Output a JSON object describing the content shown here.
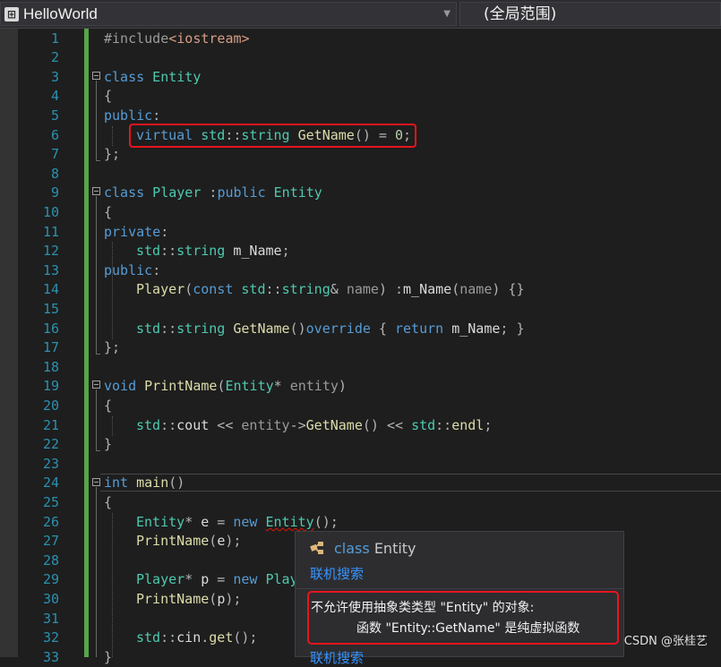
{
  "header": {
    "project_icon": "project-icon",
    "project_name": "HelloWorld",
    "scope": "(全局范围)"
  },
  "line_numbers": [
    "1",
    "2",
    "3",
    "4",
    "5",
    "6",
    "7",
    "8",
    "9",
    "10",
    "11",
    "12",
    "13",
    "14",
    "15",
    "16",
    "17",
    "18",
    "19",
    "20",
    "21",
    "22",
    "23",
    "24",
    "25",
    "26",
    "27",
    "28",
    "29",
    "30",
    "31",
    "32",
    "33"
  ],
  "code": {
    "l1": [
      "#include",
      "<iostream>"
    ],
    "l3": [
      "class",
      " Entity"
    ],
    "l4": [
      "{"
    ],
    "l5": [
      "public",
      ":"
    ],
    "l6": [
      "virtual",
      " std",
      "::",
      "string",
      " GetName",
      "()",
      " = ",
      "0",
      ";"
    ],
    "l7": [
      "};"
    ],
    "l9": [
      "class",
      " Player",
      " :",
      "public",
      " Entity"
    ],
    "l10": [
      "{"
    ],
    "l11": [
      "private",
      ":"
    ],
    "l12": [
      "std",
      "::",
      "string",
      " m_Name",
      ";"
    ],
    "l13": [
      "public",
      ":"
    ],
    "l14": [
      "Player",
      "(",
      "const",
      " std",
      "::",
      "string",
      "& ",
      "name",
      ") :",
      "m_Name",
      "(",
      "name",
      ") {}"
    ],
    "l16": [
      "std",
      "::",
      "string",
      " GetName",
      "()",
      "override",
      " { ",
      "return",
      " m_Name",
      "; }"
    ],
    "l17": [
      "};"
    ],
    "l19": [
      "void",
      " PrintName",
      "(",
      "Entity",
      "* ",
      "entity",
      ")"
    ],
    "l20": [
      "{"
    ],
    "l21": [
      "std",
      "::",
      "cout",
      " << ",
      "entity",
      "->",
      "GetName",
      "() << ",
      "std",
      "::",
      "endl",
      ";"
    ],
    "l22": [
      "}"
    ],
    "l24": [
      "int",
      " main",
      "()"
    ],
    "l25": [
      "{"
    ],
    "l26": [
      "Entity",
      "* ",
      "e",
      " = ",
      "new",
      " ",
      "Entity",
      "();"
    ],
    "l27": [
      "PrintName",
      "(",
      "e",
      ");"
    ],
    "l29": [
      "Player",
      "* ",
      "p",
      " = ",
      "new",
      " Play"
    ],
    "l30": [
      "PrintName",
      "(",
      "p",
      ");"
    ],
    "l32": [
      "std",
      "::",
      "cin",
      ".",
      "get",
      "();"
    ],
    "l33": [
      "}"
    ]
  },
  "tooltip": {
    "icon": "class-icon",
    "title_keyword": "class",
    "title_name": "Entity",
    "link": "联机搜索",
    "error_line1": "不允许使用抽象类类型 \"Entity\" 的对象:",
    "error_line2": "函数 \"Entity::GetName\" 是纯虚拟函数",
    "link2": "联机搜索"
  },
  "watermark": "CSDN @张桂艺"
}
